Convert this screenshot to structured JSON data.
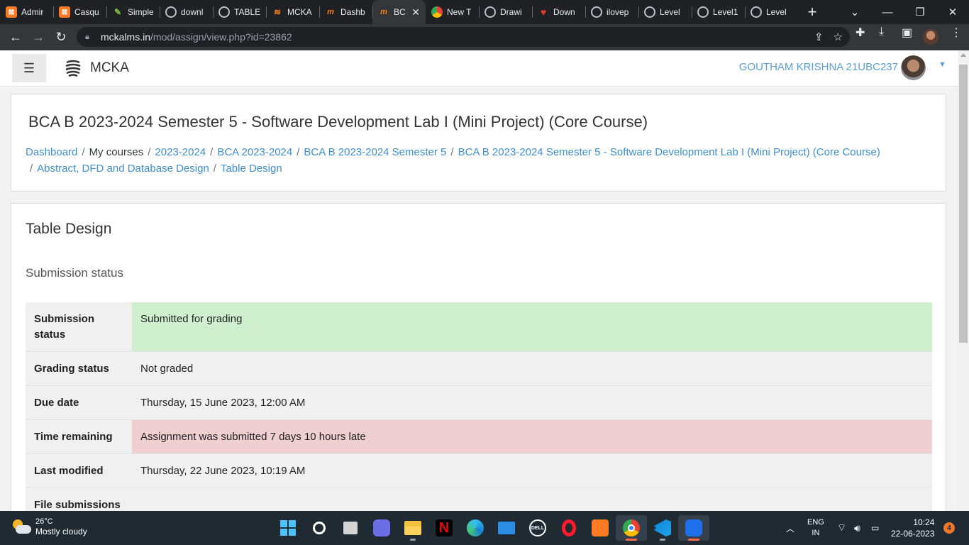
{
  "browser": {
    "tabs": [
      {
        "title": "Admir",
        "icon": "xampp-icon"
      },
      {
        "title": "Casqu",
        "icon": "xampp-icon"
      },
      {
        "title": "Simple",
        "icon": "leaf-icon"
      },
      {
        "title": "downl",
        "icon": "globe-icon"
      },
      {
        "title": "TABLE",
        "icon": "globe-icon"
      },
      {
        "title": "MCKA",
        "icon": "mcka-icon"
      },
      {
        "title": "Dashb",
        "icon": "moodle-icon"
      },
      {
        "title": "BC",
        "icon": "moodle-icon",
        "active": true
      },
      {
        "title": "New T",
        "icon": "chrome-icon"
      },
      {
        "title": "Drawi",
        "icon": "globe-icon"
      },
      {
        "title": "Down",
        "icon": "heart-icon"
      },
      {
        "title": "ilovep",
        "icon": "globe-icon"
      },
      {
        "title": "Level",
        "icon": "globe-icon"
      },
      {
        "title": "Level1",
        "icon": "globe-icon"
      },
      {
        "title": "Level",
        "icon": "globe-icon"
      }
    ],
    "url_host": "mckalms.in",
    "url_path": "/mod/assign/view.php?id=23862"
  },
  "site": {
    "name": "MCKA",
    "user_name": "GOUTHAM KRISHNA 21UBC237"
  },
  "header": {
    "course_title": "BCA B 2023-2024 Semester 5 - Software Development Lab I (Mini Project) (Core Course)",
    "breadcrumb": {
      "dashboard": "Dashboard",
      "my_courses": "My courses",
      "year": "2023-2024",
      "program": "BCA 2023-2024",
      "semester": "BCA B 2023-2024 Semester 5",
      "course": "BCA B 2023-2024 Semester 5 - Software Development Lab I (Mini Project) (Core Course)",
      "section": "Abstract, DFD and Database Design",
      "activity": "Table Design"
    }
  },
  "main": {
    "page_title": "Table Design",
    "section_title": "Submission status",
    "status_rows": [
      {
        "label": "Submission status",
        "value": "Submitted for grading",
        "status": "success"
      },
      {
        "label": "Grading status",
        "value": "Not graded",
        "status": "neutral"
      },
      {
        "label": "Due date",
        "value": "Thursday, 15 June 2023, 12:00 AM",
        "status": "neutral"
      },
      {
        "label": "Time remaining",
        "value": "Assignment was submitted 7 days 10 hours late",
        "status": "danger"
      },
      {
        "label": "Last modified",
        "value": "Thursday, 22 June 2023, 10:19 AM",
        "status": "neutral"
      },
      {
        "label": "File submissions",
        "value": "",
        "status": "neutral"
      }
    ]
  },
  "taskbar": {
    "weather_temp": "26°C",
    "weather_condition": "Mostly cloudy",
    "lang_line1": "ENG",
    "lang_line2": "IN",
    "time": "10:24",
    "date": "22-06-2023",
    "notification_count": "4"
  },
  "colors": {
    "link": "#3f8fd2",
    "success_bg": "#cfefcf",
    "danger_bg": "#efcfd1"
  }
}
